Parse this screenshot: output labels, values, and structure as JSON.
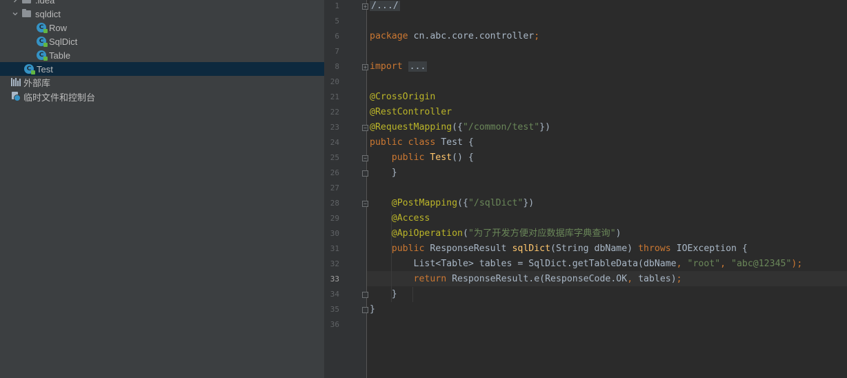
{
  "project_tree": {
    "items": [
      {
        "label": ".idea",
        "icon": "folder-icon",
        "expanded": false
      },
      {
        "label": "sqldict",
        "icon": "folder-icon",
        "expanded": true
      },
      {
        "label": "Row",
        "icon": "java-class-icon"
      },
      {
        "label": "SqlDict",
        "icon": "java-class-icon"
      },
      {
        "label": "Table",
        "icon": "java-class-icon"
      },
      {
        "label": "Test",
        "icon": "java-class-icon",
        "selected": true
      },
      {
        "label": "外部库",
        "icon": "library-icon"
      },
      {
        "label": "临时文件和控制台",
        "icon": "scratches-icon"
      }
    ]
  },
  "editor": {
    "current_line": "33",
    "lines": [
      {
        "n": "1",
        "tokens": [
          {
            "t": "/.../",
            "c": "folded"
          }
        ]
      },
      {
        "n": "5",
        "tokens": []
      },
      {
        "n": "6",
        "tokens": [
          {
            "t": "package ",
            "c": "kw"
          },
          {
            "t": "cn.abc.core.controller"
          },
          {
            "t": ";",
            "c": "kw"
          }
        ]
      },
      {
        "n": "7",
        "tokens": []
      },
      {
        "n": "8",
        "tokens": [
          {
            "t": "import ",
            "c": "kw"
          },
          {
            "t": "...",
            "c": "folded"
          }
        ]
      },
      {
        "n": "20",
        "tokens": []
      },
      {
        "n": "21",
        "tokens": [
          {
            "t": "@CrossOrigin",
            "c": "an"
          }
        ]
      },
      {
        "n": "22",
        "tokens": [
          {
            "t": "@RestController",
            "c": "an"
          }
        ]
      },
      {
        "n": "23",
        "tokens": [
          {
            "t": "@RequestMapping",
            "c": "an"
          },
          {
            "t": "({"
          },
          {
            "t": "\"/common/test\"",
            "c": "st"
          },
          {
            "t": "})"
          }
        ]
      },
      {
        "n": "24",
        "tokens": [
          {
            "t": "public class ",
            "c": "kw"
          },
          {
            "t": "Test {"
          }
        ]
      },
      {
        "n": "25",
        "tokens": [
          {
            "t": "    "
          },
          {
            "t": "public ",
            "c": "kw"
          },
          {
            "t": "Test",
            "c": "fn"
          },
          {
            "t": "() {"
          }
        ]
      },
      {
        "n": "26",
        "tokens": [
          {
            "t": "    }"
          }
        ]
      },
      {
        "n": "27",
        "tokens": []
      },
      {
        "n": "28",
        "tokens": [
          {
            "t": "    "
          },
          {
            "t": "@PostMapping",
            "c": "an"
          },
          {
            "t": "({"
          },
          {
            "t": "\"/sqlDict\"",
            "c": "st"
          },
          {
            "t": "})"
          }
        ]
      },
      {
        "n": "29",
        "tokens": [
          {
            "t": "    "
          },
          {
            "t": "@Access",
            "c": "an"
          }
        ]
      },
      {
        "n": "30",
        "tokens": [
          {
            "t": "    "
          },
          {
            "t": "@ApiOperation",
            "c": "an"
          },
          {
            "t": "("
          },
          {
            "t": "\"为了开发方便对应数据库字典查询\"",
            "c": "st"
          },
          {
            "t": ")"
          }
        ]
      },
      {
        "n": "31",
        "tokens": [
          {
            "t": "    "
          },
          {
            "t": "public ",
            "c": "kw"
          },
          {
            "t": "ResponseResult "
          },
          {
            "t": "sqlDict",
            "c": "fn"
          },
          {
            "t": "(String dbName) "
          },
          {
            "t": "throws ",
            "c": "kw"
          },
          {
            "t": "IOException {"
          }
        ]
      },
      {
        "n": "32",
        "tokens": [
          {
            "t": "        List<Table> tables = SqlDict.getTableData(dbName"
          },
          {
            "t": ", ",
            "c": "kw"
          },
          {
            "t": "\"root\"",
            "c": "st"
          },
          {
            "t": ", ",
            "c": "kw"
          },
          {
            "t": "\"abc@12345\"",
            "c": "st"
          },
          {
            "t": ");",
            "c": "kw"
          }
        ]
      },
      {
        "n": "33",
        "tokens": [
          {
            "t": "        "
          },
          {
            "t": "return ",
            "c": "kw"
          },
          {
            "t": "ResponseResult.e(ResponseCode.OK"
          },
          {
            "t": ", ",
            "c": "kw"
          },
          {
            "t": "tables)"
          },
          {
            "t": ";",
            "c": "kw"
          }
        ]
      },
      {
        "n": "34",
        "tokens": [
          {
            "t": "    }"
          }
        ]
      },
      {
        "n": "35",
        "tokens": [
          {
            "t": "}"
          }
        ]
      },
      {
        "n": "36",
        "tokens": []
      }
    ]
  }
}
